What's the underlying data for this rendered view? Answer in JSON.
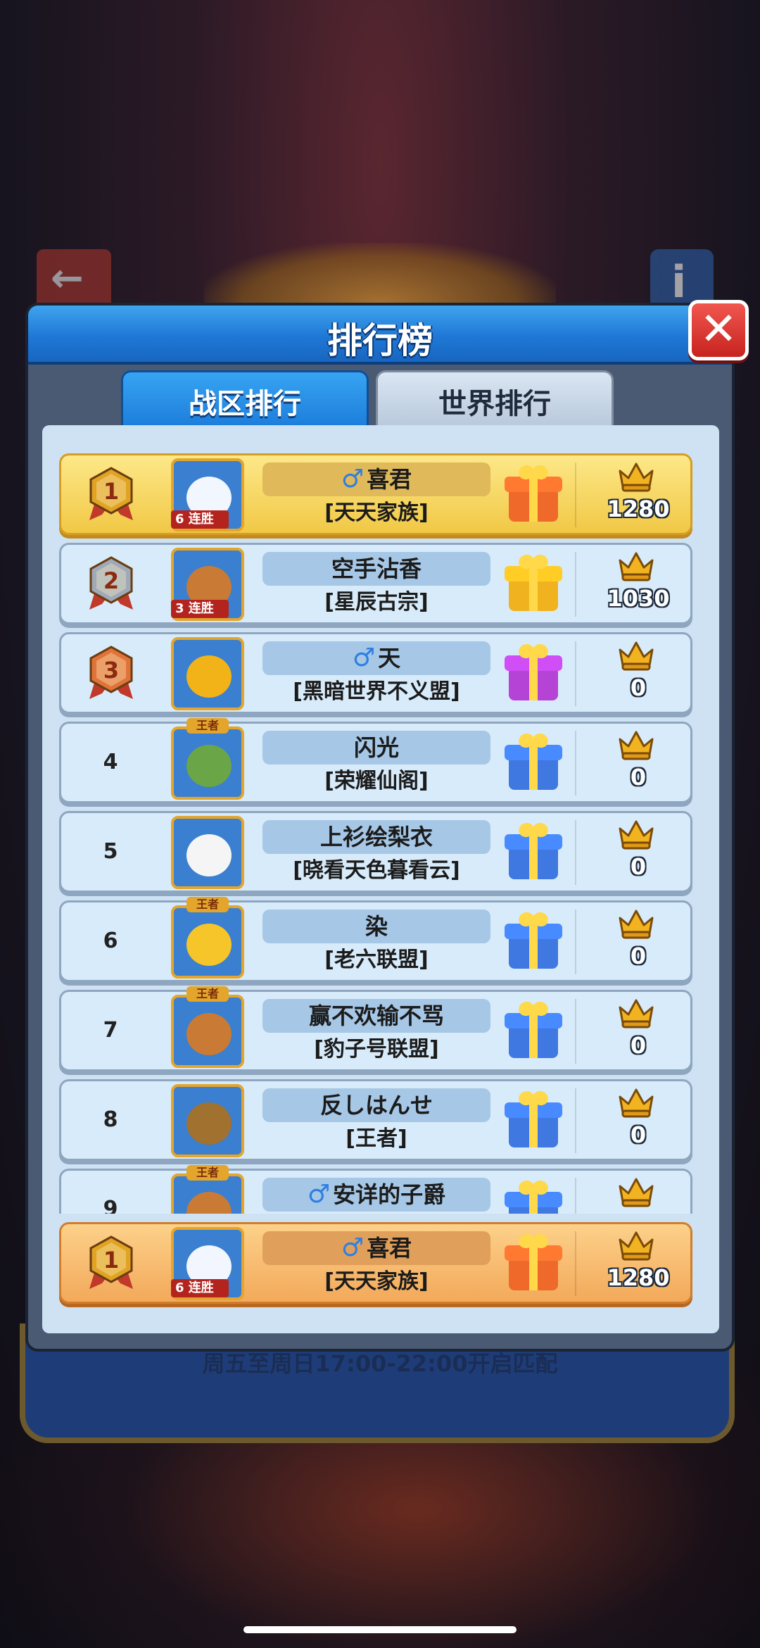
{
  "background": {
    "back_icon": "←",
    "info_icon": "i",
    "footer_text": "周五至周日17:00-22:00开启匹配"
  },
  "modal": {
    "title": "排行榜",
    "close_icon": "✕"
  },
  "tabs": [
    {
      "label": "战区排行",
      "active": true
    },
    {
      "label": "世界排行",
      "active": false
    }
  ],
  "rows": [
    {
      "rank": "1",
      "medal": "gold",
      "gender": "♂",
      "name": "喜君",
      "guild": "[天天家族]",
      "score": "1280",
      "gift_color": "#ef6a2a",
      "streak": "6 连胜",
      "avatar_color": "#f2f6ff",
      "frame_tag": ""
    },
    {
      "rank": "2",
      "medal": "silver",
      "gender": "",
      "name": "空手沾香",
      "guild": "[星辰古宗]",
      "score": "1030",
      "gift_color": "#f0b21f",
      "streak": "3 连胜",
      "avatar_color": "#c97a35",
      "frame_tag": ""
    },
    {
      "rank": "3",
      "medal": "bronze",
      "gender": "♂",
      "name": "天",
      "guild": "[黑暗世界不义盟]",
      "score": "0",
      "gift_color": "#b544d6",
      "streak": "",
      "avatar_color": "#f2b318",
      "frame_tag": ""
    },
    {
      "rank": "4",
      "medal": "",
      "gender": "",
      "name": "闪光",
      "guild": "[荣耀仙阁]",
      "score": "0",
      "gift_color": "#3f78e0",
      "streak": "",
      "avatar_color": "#6aa548",
      "frame_tag": "王者"
    },
    {
      "rank": "5",
      "medal": "",
      "gender": "",
      "name": "上衫绘梨衣",
      "guild": "[晓看天色暮看云]",
      "score": "0",
      "gift_color": "#3f78e0",
      "streak": "",
      "avatar_color": "#f5f5f5",
      "frame_tag": ""
    },
    {
      "rank": "6",
      "medal": "",
      "gender": "",
      "name": "染",
      "guild": "[老六联盟]",
      "score": "0",
      "gift_color": "#3f78e0",
      "streak": "",
      "avatar_color": "#f6c52a",
      "frame_tag": "王者"
    },
    {
      "rank": "7",
      "medal": "",
      "gender": "",
      "name": "赢不欢输不骂",
      "guild": "[豹子号联盟]",
      "score": "0",
      "gift_color": "#3f78e0",
      "streak": "",
      "avatar_color": "#c97a35",
      "frame_tag": "王者"
    },
    {
      "rank": "8",
      "medal": "",
      "gender": "",
      "name": "反しはんせ",
      "guild": "[王者]",
      "score": "0",
      "gift_color": "#3f78e0",
      "streak": "",
      "avatar_color": "#a0712f",
      "frame_tag": ""
    },
    {
      "rank": "9",
      "medal": "",
      "gender": "♂",
      "name": "安详的子爵",
      "guild": "",
      "score": "",
      "gift_color": "#3f78e0",
      "streak": "",
      "avatar_color": "#c97a35",
      "frame_tag": "王者"
    }
  ],
  "self_row": {
    "rank": "1",
    "medal": "gold",
    "gender": "♂",
    "name": "喜君",
    "guild": "[天天家族]",
    "score": "1280",
    "gift_color": "#ef6a2a",
    "streak": "6 连胜",
    "avatar_color": "#f2f6ff",
    "frame_tag": ""
  },
  "colors": {
    "medal_gold": "#e0a324",
    "medal_silver": "#9fa9b8",
    "medal_bronze": "#e0733a",
    "crown": "#f2b321"
  }
}
